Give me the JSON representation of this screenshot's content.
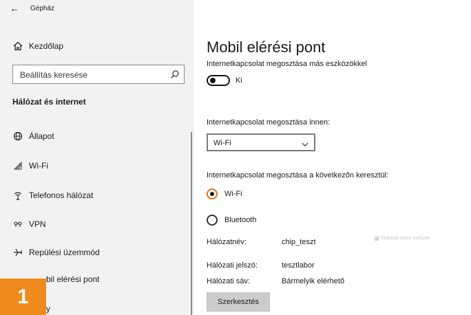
{
  "window": {
    "title": "Gépház",
    "back_icon": "back-arrow-icon"
  },
  "sidebar": {
    "home": {
      "label": "Kezdőlap",
      "icon": "home-icon"
    },
    "search": {
      "placeholder": "Beállítás keresése",
      "icon": "search-icon"
    },
    "section_title": "Hálózat és internet",
    "items": [
      {
        "label": "Állapot",
        "icon": "globe-icon"
      },
      {
        "label": "Wi-Fi",
        "icon": "wifi-icon"
      },
      {
        "label": "Telefonos hálózat",
        "icon": "cellular-icon"
      },
      {
        "label": "VPN",
        "icon": "vpn-icon"
      },
      {
        "label": "Repülési üzemmód",
        "icon": "airplane-icon"
      },
      {
        "label": "bil elérési pont",
        "icon": "hotspot-icon"
      },
      {
        "label": "y",
        "icon": "proxy-icon"
      }
    ]
  },
  "badge": {
    "number": "1",
    "color": "#f08a1c"
  },
  "main": {
    "title": "Mobil elérési pont",
    "share_label": "Internetkapcsolat megosztása más eszközökkel",
    "toggle": {
      "state_label": "Ki",
      "on": false
    },
    "share_from_label": "Internetkapcsolat megosztása innen:",
    "share_from_select": {
      "value": "Wi-Fi"
    },
    "share_over_label": "Internetkapcsolat megosztása a következőn keresztül:",
    "radio_options": [
      {
        "label": "Wi-Fi",
        "checked": true
      },
      {
        "label": "Bluetooth",
        "checked": false
      }
    ],
    "network_info": [
      {
        "key": "Hálózatnév:",
        "value": "chip_teszt"
      },
      {
        "key": "Hálózati jelszó:",
        "value": "tesztlabor"
      },
      {
        "key": "Hálózati sáv:",
        "value": "Bármelyik elérhető"
      }
    ],
    "edit_button": "Szerkesztés",
    "snip_hint": "Téglalap alakú metszet"
  },
  "colors": {
    "accent_radio": "#e8701a",
    "sidebar_bg": "#f2f2f2",
    "button_bg": "#cccccc"
  }
}
